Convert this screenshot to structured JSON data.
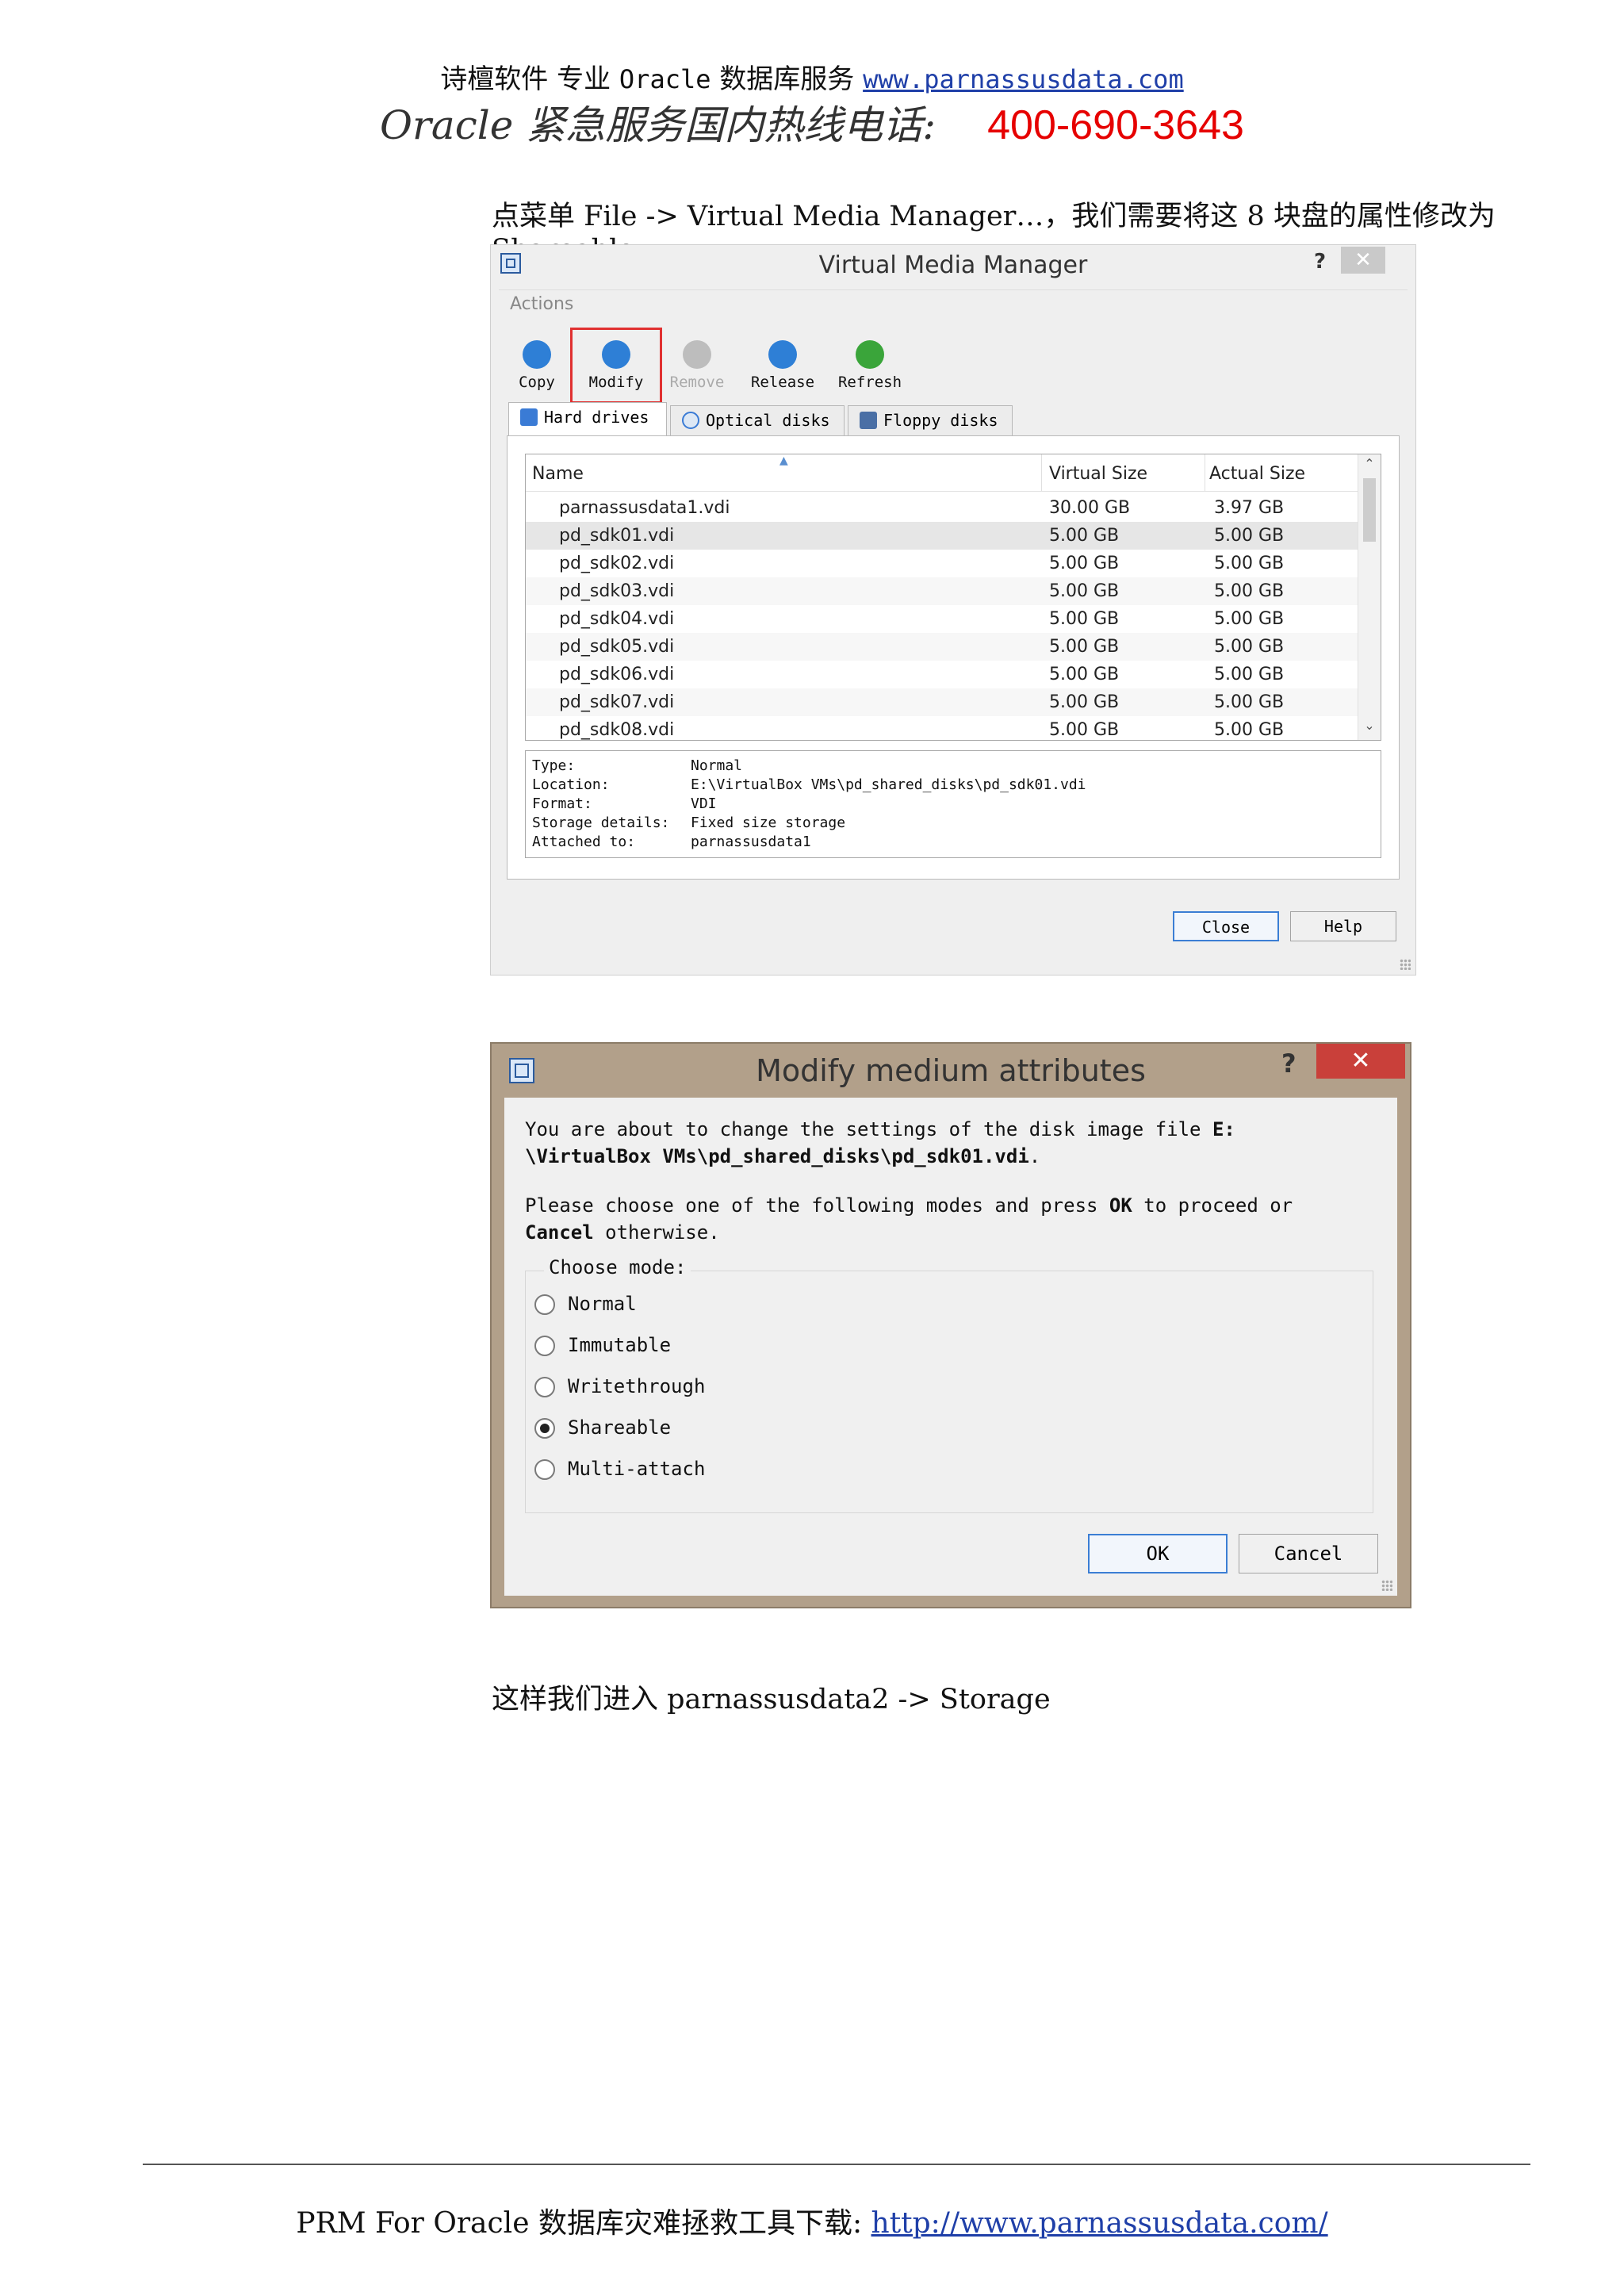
{
  "header": {
    "line1_prefix": "诗檀软件  专业",
    "line1_oracle": "Oracle",
    "line1_mid": "数据库服务",
    "line1_url": "www.parnassusdata.com",
    "line2_slogan": "Oracle 紧急服务国内热线电话:",
    "line2_phone": "400-690-3643"
  },
  "intro_text": "点菜单 File -> Virtual Media Manager…，我们需要将这 8 块盘的属性修改为 Shareable",
  "vmm": {
    "title": "Virtual Media Manager",
    "help_glyph": "?",
    "close_glyph": "✕",
    "actions_label": "Actions",
    "toolbar": [
      {
        "label": "Copy",
        "icon": "copy-icon",
        "color": "#2e7fd6",
        "enabled": true
      },
      {
        "label": "Modify",
        "icon": "modify-icon",
        "color": "#2e7fd6",
        "enabled": true
      },
      {
        "label": "Remove",
        "icon": "remove-icon",
        "color": "#bdbdbd",
        "enabled": false
      },
      {
        "label": "Release",
        "icon": "release-icon",
        "color": "#2e7fd6",
        "enabled": true
      },
      {
        "label": "Refresh",
        "icon": "refresh-icon",
        "color": "#3aa53a",
        "enabled": true
      }
    ],
    "tabs": [
      "Hard drives",
      "Optical disks",
      "Floppy disks"
    ],
    "columns": [
      "Name",
      "Virtual Size",
      "Actual Size"
    ],
    "rows": [
      {
        "name": "parnassusdata1.vdi",
        "virtual": "30.00 GB",
        "actual": "3.97 GB"
      },
      {
        "name": "pd_sdk01.vdi",
        "virtual": "5.00 GB",
        "actual": "5.00 GB"
      },
      {
        "name": "pd_sdk02.vdi",
        "virtual": "5.00 GB",
        "actual": "5.00 GB"
      },
      {
        "name": "pd_sdk03.vdi",
        "virtual": "5.00 GB",
        "actual": "5.00 GB"
      },
      {
        "name": "pd_sdk04.vdi",
        "virtual": "5.00 GB",
        "actual": "5.00 GB"
      },
      {
        "name": "pd_sdk05.vdi",
        "virtual": "5.00 GB",
        "actual": "5.00 GB"
      },
      {
        "name": "pd_sdk06.vdi",
        "virtual": "5.00 GB",
        "actual": "5.00 GB"
      },
      {
        "name": "pd_sdk07.vdi",
        "virtual": "5.00 GB",
        "actual": "5.00 GB"
      },
      {
        "name": "pd_sdk08.vdi",
        "virtual": "5.00 GB",
        "actual": "5.00 GB"
      }
    ],
    "selected_row": 1,
    "details": [
      {
        "key": "Type:",
        "value": "Normal"
      },
      {
        "key": "Location:",
        "value": "E:\\VirtualBox  VMs\\pd_shared_disks\\pd_sdk01.vdi"
      },
      {
        "key": "Format:",
        "value": "VDI"
      },
      {
        "key": "Storage details:",
        "value": "Fixed size storage"
      },
      {
        "key": "Attached to:",
        "value": "parnassusdata1"
      }
    ],
    "close_label": "Close",
    "help_label": "Help"
  },
  "modify": {
    "title": "Modify medium attributes",
    "help_glyph": "?",
    "close_glyph": "✕",
    "msg1_a": "You are about to change the settings of the disk image file ",
    "msg1_b": "E:",
    "msg1_c": "\\VirtualBox VMs\\pd_shared_disks\\pd_sdk01.vdi",
    "msg1_d": ".",
    "msg2_a": "Please choose one of the following modes and press ",
    "msg2_b": "OK",
    "msg2_c": " to proceed or",
    "msg3_a": "Cancel",
    "msg3_b": " otherwise.",
    "choose_mode": "Choose mode:",
    "modes": [
      "Normal",
      "Immutable",
      "Writethrough",
      "Shareable",
      "Multi-attach"
    ],
    "selected_mode": 3,
    "ok_label": "OK",
    "cancel_label": "Cancel"
  },
  "after_text": "这样我们进入 parnassusdata2 -> Storage",
  "footer": {
    "text": "PRM For Oracle 数据库灾难拯救工具下载: ",
    "url": "http://www.parnassusdata.com/"
  }
}
